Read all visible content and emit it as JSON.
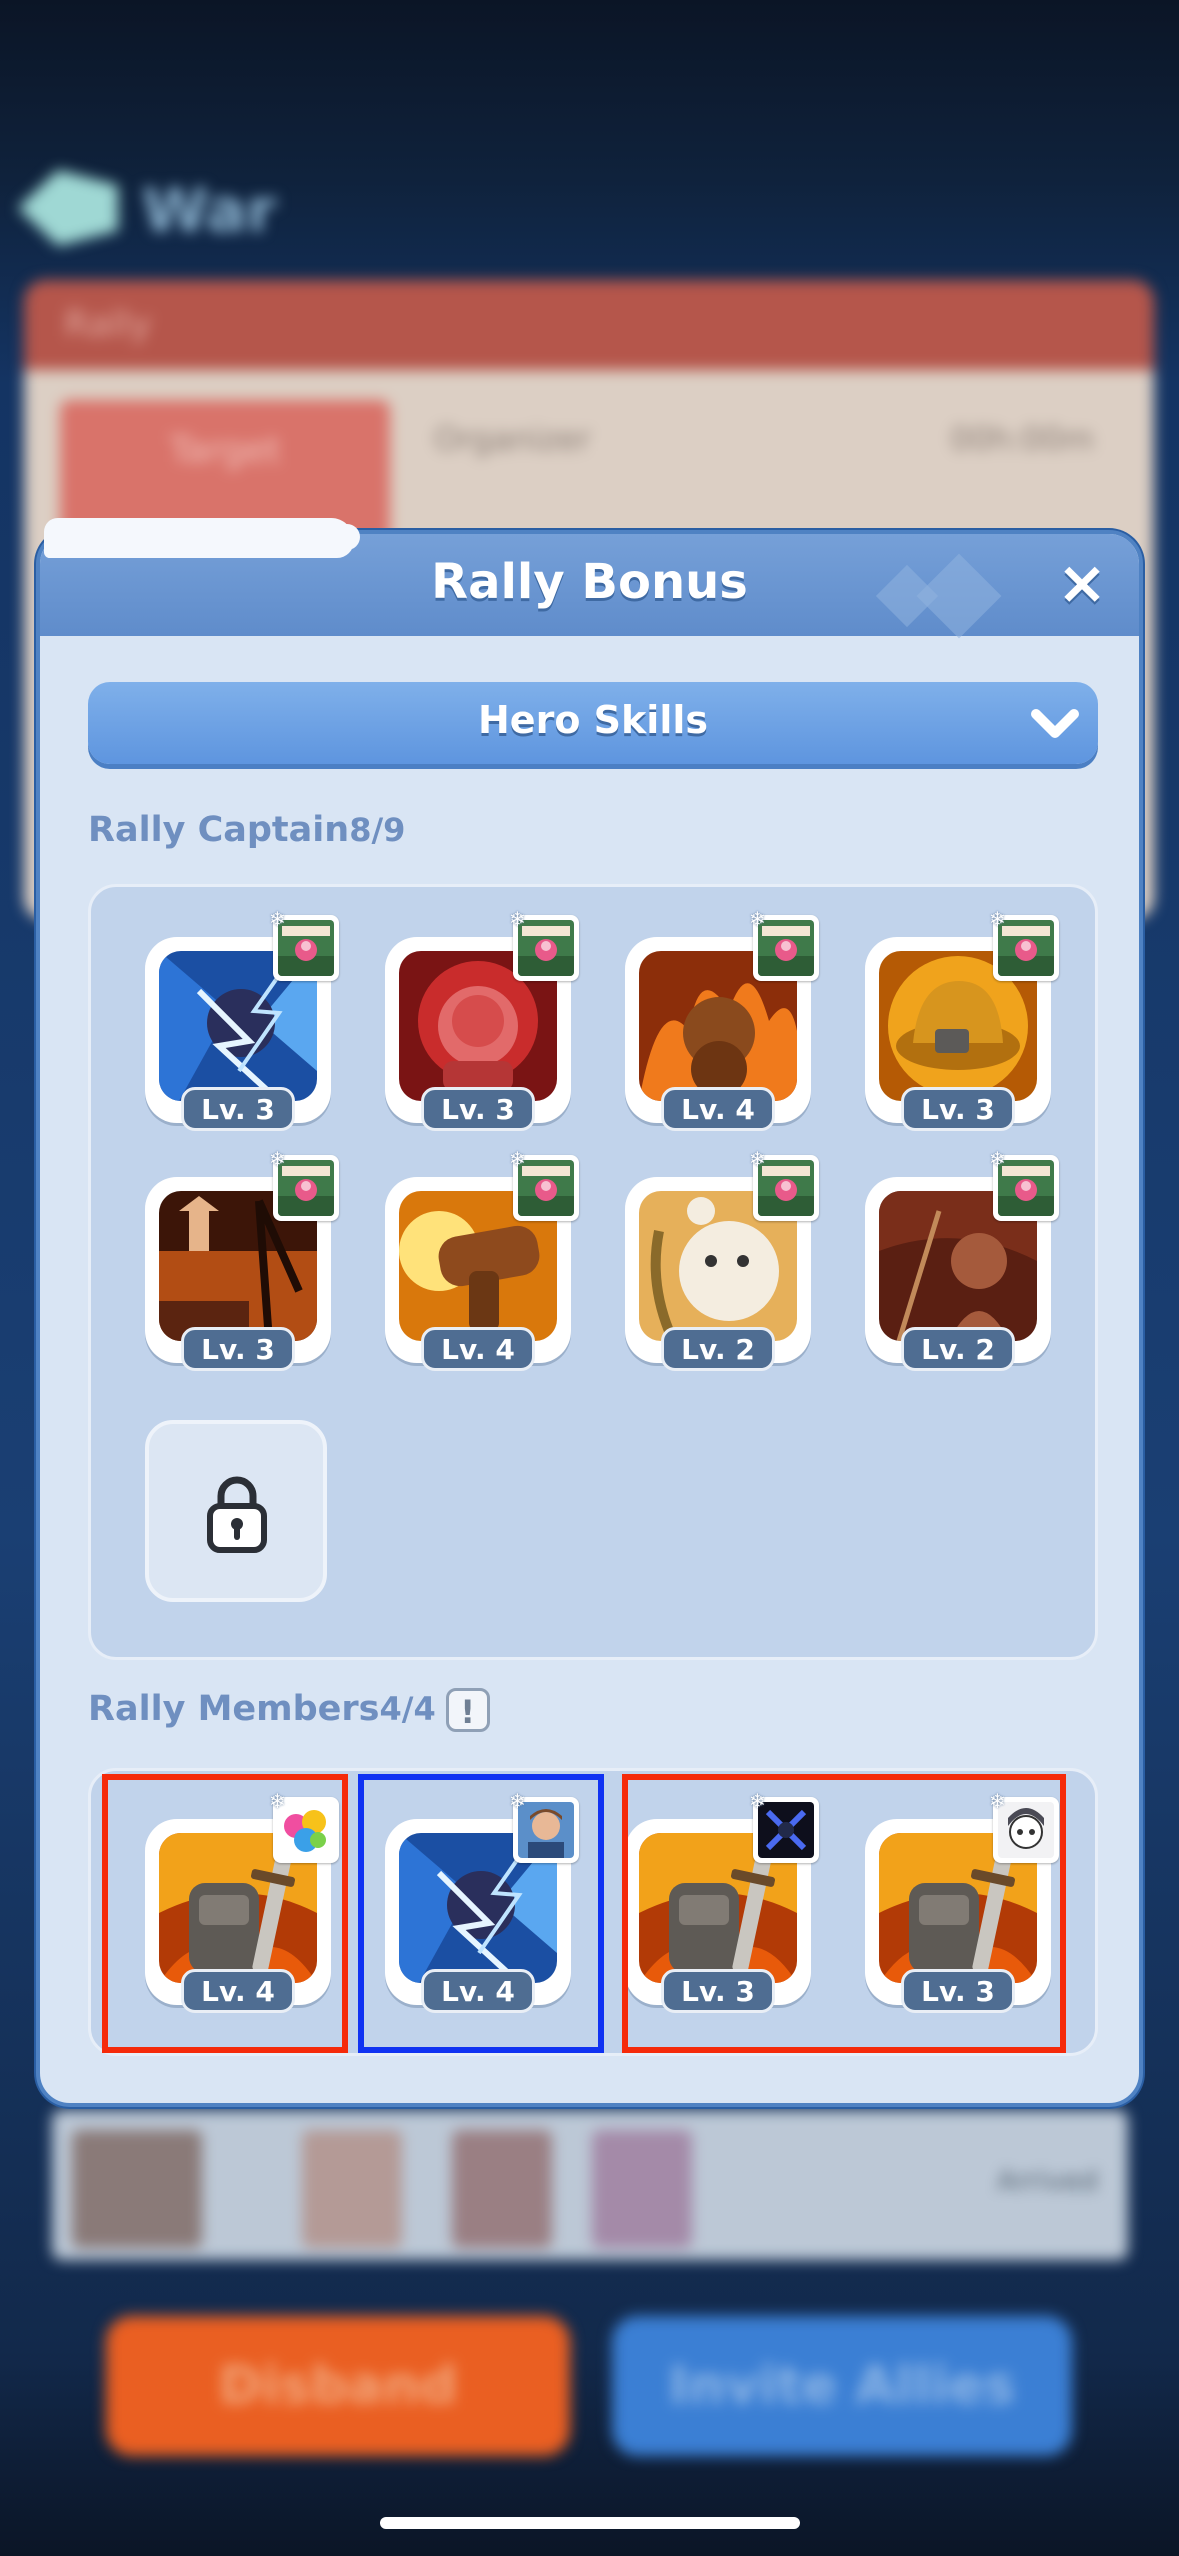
{
  "background": {
    "title": "War",
    "card_header": "Rally",
    "card_thumb_label": "Target",
    "card_line_left": "Organizer",
    "card_line_right": "00h:00m",
    "list_status": "Arrived",
    "disband_label": "Disband",
    "invite_label": "Invite Allies"
  },
  "modal": {
    "title": "Rally Bonus",
    "close_icon": "×",
    "dropdown_label": "Hero Skills",
    "captain_label": "Rally Captain",
    "captain_count": "8/9",
    "members_label": "Rally Members",
    "members_count": "4/4",
    "members_info_icon": "!"
  },
  "captain_skills": [
    {
      "level": "Lv. 3",
      "icon": "lightning-hero-skill-icon"
    },
    {
      "level": "Lv. 3",
      "icon": "red-rage-skill-icon"
    },
    {
      "level": "Lv. 4",
      "icon": "flame-bear-skill-icon"
    },
    {
      "level": "Lv. 3",
      "icon": "golden-helmet-skill-icon"
    },
    {
      "level": "Lv. 3",
      "icon": "oil-rig-skill-icon"
    },
    {
      "level": "Lv. 4",
      "icon": "cannon-skill-icon"
    },
    {
      "level": "Lv. 2",
      "icon": "white-bear-skill-icon"
    },
    {
      "level": "Lv. 2",
      "icon": "spear-girl-skill-icon"
    }
  ],
  "member_skills": [
    {
      "level": "Lv. 4",
      "icon": "armor-sword-skill-icon",
      "avatar": "colorful-avatar-icon"
    },
    {
      "level": "Lv. 4",
      "icon": "lightning-hero-skill-icon",
      "avatar": "hero-portrait-avatar-icon"
    },
    {
      "level": "Lv. 3",
      "icon": "armor-sword-skill-icon",
      "avatar": "dark-x-avatar-icon"
    },
    {
      "level": "Lv. 3",
      "icon": "armor-sword-skill-icon",
      "avatar": "anime-girl-avatar-icon"
    }
  ],
  "colors": {
    "highlight_red": "#f52a0a",
    "highlight_blue": "#1032f2",
    "modal_bg": "#d9e5f4",
    "accent_blue": "#5e95df"
  }
}
